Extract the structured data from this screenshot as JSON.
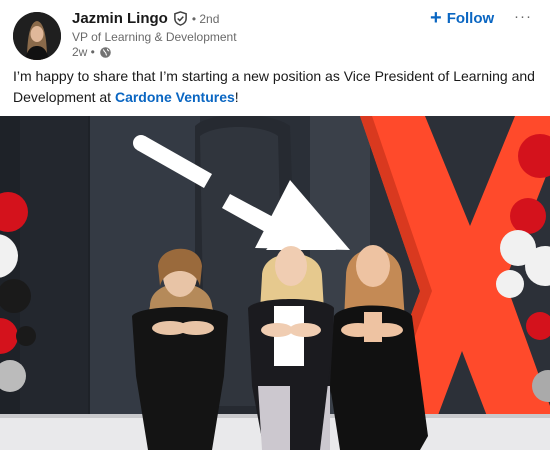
{
  "post": {
    "author": {
      "name": "Jazmin Lingo",
      "degree": "• 2nd",
      "headline": "VP of Learning & Development",
      "timestamp": "2w •"
    },
    "follow_label": "Follow",
    "more_label": "···",
    "text_before": "I’m happy to share that I’m starting a new position as Vice President of Learning and Development at ",
    "mention": "Cardone Ventures",
    "text_after": "!"
  },
  "colors": {
    "accent": "#0a66c2",
    "photo_backdrop": "#2c3038",
    "brand_x": "#ff4a2b",
    "balloon_red": "#d4121c",
    "balloon_white": "#f1f1f1",
    "balloon_black": "#1a1a1a"
  },
  "icons": {
    "verified": "verified-shield-icon",
    "globe": "globe-icon",
    "follow_plus": "plus-icon",
    "more": "ellipsis-icon"
  }
}
